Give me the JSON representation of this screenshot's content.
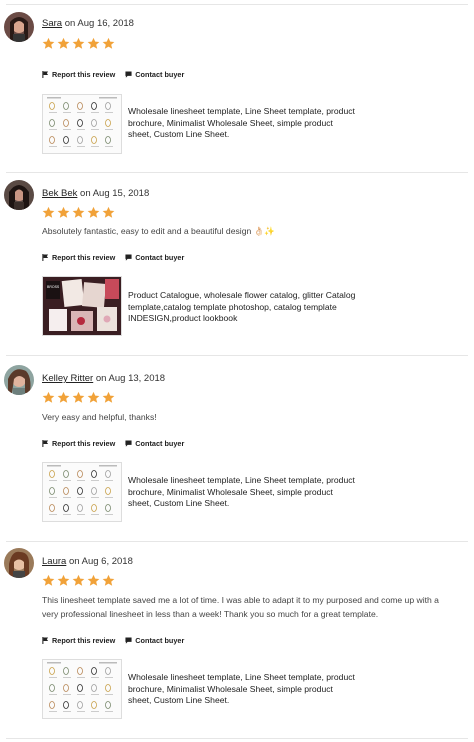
{
  "reviews": [
    {
      "reviewer": "Sara",
      "date_text": "on Aug 16, 2018",
      "rating": 5,
      "text": "",
      "report_label": "Report this review",
      "contact_label": "Contact buyer",
      "listing_title": "Wholesale linesheet template, Line Sheet template, product brochure, Minimalist Wholesale Sheet, simple product sheet, Custom Line Sheet."
    },
    {
      "reviewer": "Bek Bek",
      "date_text": "on Aug 15, 2018",
      "rating": 5,
      "text": "Absolutely fantastic, easy to edit and a beautiful design 👌🏻✨",
      "report_label": "Report this review",
      "contact_label": "Contact buyer",
      "listing_title": "Product Catalogue, wholesale flower catalog, glitter Catalog template,catalog template photoshop, catalog template INDESIGN,product lookbook"
    },
    {
      "reviewer": "Kelley Ritter",
      "date_text": "on Aug 13, 2018",
      "rating": 5,
      "text": "Very easy and helpful, thanks!",
      "report_label": "Report this review",
      "contact_label": "Contact buyer",
      "listing_title": "Wholesale linesheet template, Line Sheet template, product brochure, Minimalist Wholesale Sheet, simple product sheet, Custom Line Sheet."
    },
    {
      "reviewer": "Laura",
      "date_text": "on Aug 6, 2018",
      "rating": 5,
      "text": "This linesheet template saved me a lot of time. I was able to adapt it to my purposed and come up with a very professional linesheet in less than a week! Thank you so much for a great template.",
      "report_label": "Report this review",
      "contact_label": "Contact buyer",
      "listing_title": "Wholesale linesheet template, Line Sheet template, product brochure, Minimalist Wholesale Sheet, simple product sheet, Custom Line Sheet."
    }
  ],
  "colors": {
    "star": "#f1a239",
    "divider": "#e6e6e6"
  }
}
